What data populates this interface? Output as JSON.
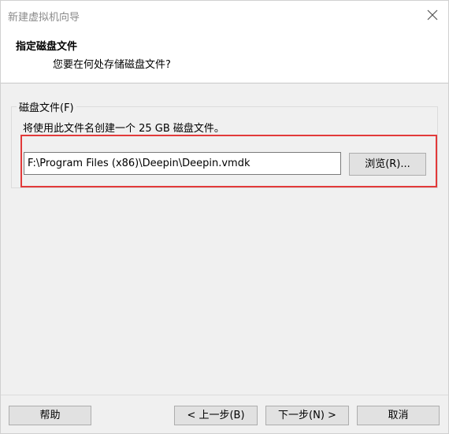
{
  "window": {
    "title": "新建虚拟机向导"
  },
  "header": {
    "title": "指定磁盘文件",
    "subtitle": "您要在何处存储磁盘文件?"
  },
  "disk_file_group": {
    "legend": "磁盘文件(F)",
    "description": "将使用此文件名创建一个 25 GB 磁盘文件。",
    "path_value": "F:\\Program Files (x86)\\Deepin\\Deepin.vmdk",
    "browse_label": "浏览(R)..."
  },
  "footer": {
    "help_label": "帮助",
    "back_label": "< 上一步(B)",
    "next_label": "下一步(N) >",
    "cancel_label": "取消"
  },
  "colors": {
    "highlight_border": "#e23a3a",
    "window_bg": "#f0f0f0",
    "header_bg": "#ffffff"
  },
  "icons": {
    "close": "close-icon"
  }
}
